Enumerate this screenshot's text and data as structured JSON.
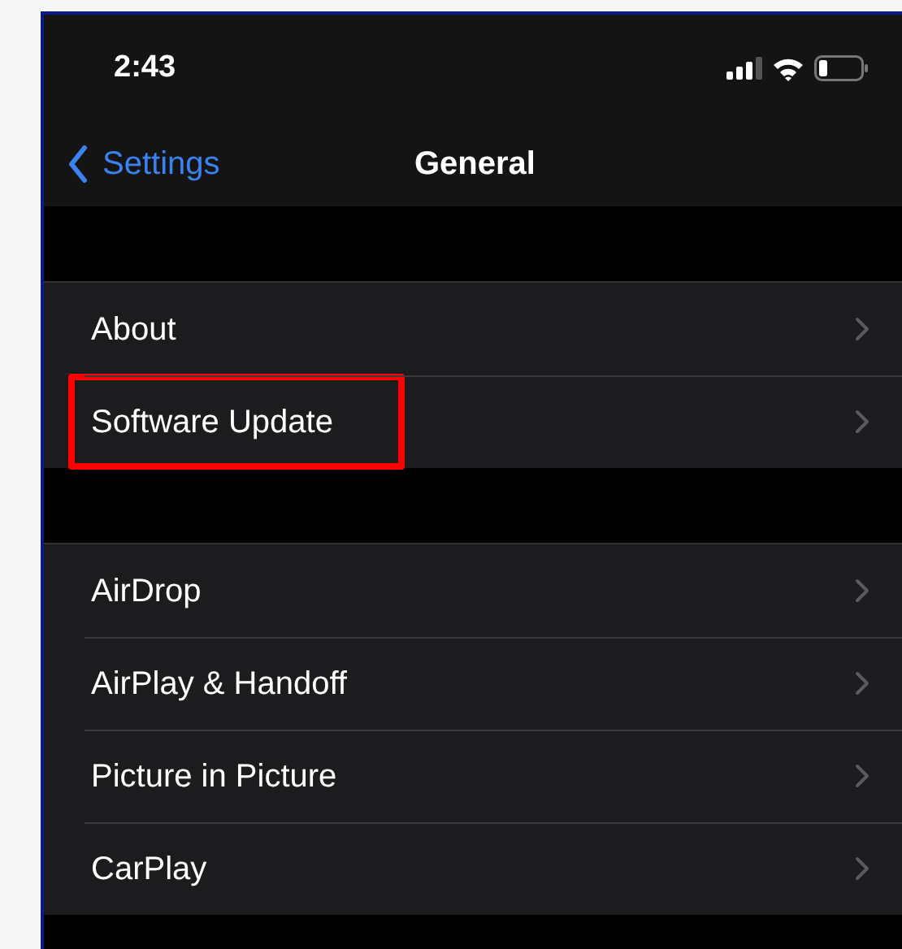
{
  "status_bar": {
    "time": "2:43"
  },
  "nav": {
    "back_label": "Settings",
    "title": "General"
  },
  "groups": [
    {
      "rows": [
        {
          "label": "About",
          "highlighted": false
        },
        {
          "label": "Software Update",
          "highlighted": true
        }
      ]
    },
    {
      "rows": [
        {
          "label": "AirDrop",
          "highlighted": false
        },
        {
          "label": "AirPlay & Handoff",
          "highlighted": false
        },
        {
          "label": "Picture in Picture",
          "highlighted": false
        },
        {
          "label": "CarPlay",
          "highlighted": false
        }
      ]
    }
  ]
}
